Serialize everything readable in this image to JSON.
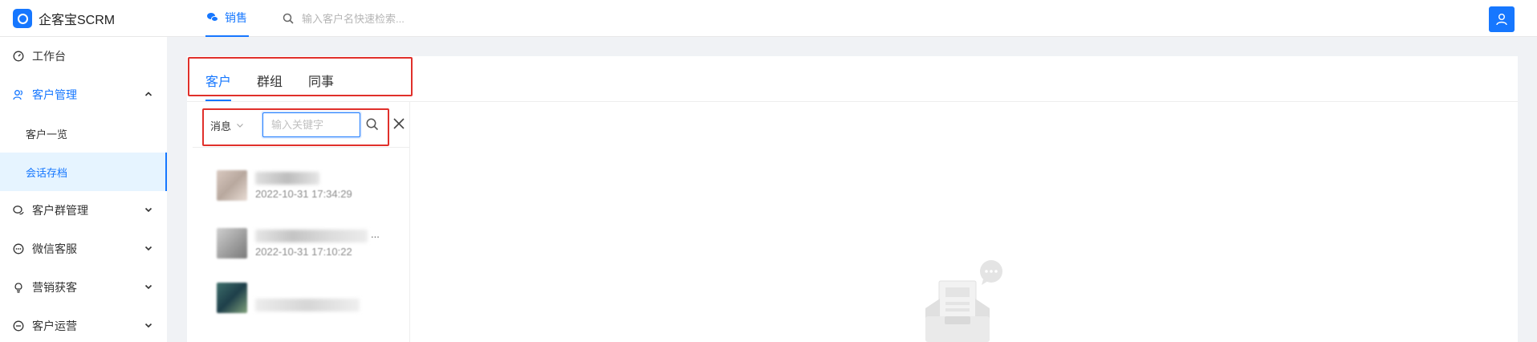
{
  "app": {
    "name": "企客宝SCRM"
  },
  "topnav": {
    "active_label": "销售"
  },
  "search": {
    "placeholder": "输入客户名快速检索..."
  },
  "sidebar": {
    "items": [
      {
        "label": "工作台",
        "icon": "dashboard-icon"
      },
      {
        "label": "客户管理",
        "icon": "customers-icon",
        "expanded": true
      },
      {
        "label": "客户一览"
      },
      {
        "label": "会话存档",
        "active": true
      },
      {
        "label": "客户群管理",
        "icon": "group-chat-icon"
      },
      {
        "label": "微信客服",
        "icon": "wechat-service-icon"
      },
      {
        "label": "营销获客",
        "icon": "bulb-icon"
      },
      {
        "label": "客户运营",
        "icon": "operation-icon"
      }
    ]
  },
  "tabs": [
    {
      "label": "客户",
      "active": true
    },
    {
      "label": "群组"
    },
    {
      "label": "同事"
    }
  ],
  "filter": {
    "type_value": "消息",
    "keyword_placeholder": "输入关键字"
  },
  "conversations": [
    {
      "time": "2022-10-31 17:34:29"
    },
    {
      "time": "2022-10-31 17:10:22",
      "name_suffix": "..."
    },
    {
      "time": ""
    }
  ],
  "colors": {
    "accent": "#1677ff",
    "highlight_box": "#e0302b",
    "active_bg": "#e6f4ff"
  }
}
